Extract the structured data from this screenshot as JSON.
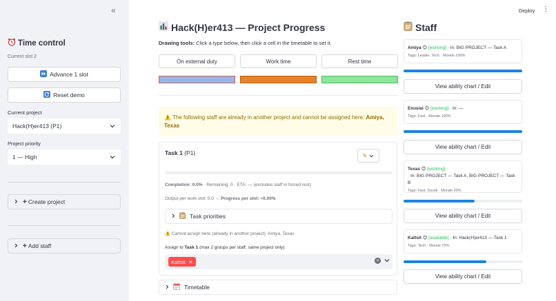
{
  "sidebar": {
    "collapse_glyph": "«",
    "time_control_title": "Time control",
    "current_slot": "Current slot 2",
    "advance_label": "Advance 1 slot",
    "reset_label": "Reset demo",
    "current_project_label": "Current project",
    "current_project_value": "Hack(H)er413 (P1)",
    "priority_label": "Project priority",
    "priority_value": "1 — High",
    "create_project_label": "Create project",
    "add_staff_label": "Add staff"
  },
  "topbar": {
    "deploy_label": "Deploy",
    "menu_glyph": "⋮"
  },
  "main": {
    "title": "Hack(H)er413 — Project Progress",
    "drawing_tools_bold": "Drawing tools:",
    "drawing_tools_text": " Click a type below, then click a cell in the timetable to set it.",
    "modes": [
      {
        "label": "On external duty",
        "color": "#8fb8ec",
        "border": "#e05a4f"
      },
      {
        "label": "Work time",
        "color": "#e8822a",
        "border": "#b85d12"
      },
      {
        "label": "Rest time",
        "color": "#8ee59c",
        "border": "#4fb862"
      }
    ],
    "warning_text": "The following staff are already in another project and cannot be assigned here: ",
    "warning_names": "Amiya, Texas",
    "task": {
      "name": "Task 1",
      "priority": " (P1)",
      "edit_glyph": "✎",
      "completion_label": "Completion: 0.0%",
      "completion_rest": " · Remaining: 0 · ETA: — (excludes staff in forced rest)",
      "output_text": "Output per work slot: 0.0 → ",
      "output_bold": "Progress per slot: +0.00%",
      "priorities_label": "Task priorities",
      "cannot_assign": "Cannot assign here (already in another project): Amiya, Texas",
      "assign_prefix": "Assign to ",
      "assign_task": "Task 1",
      "assign_suffix": " (max 2 groups per staff; same project only)",
      "selected_tag": "Kaltsit",
      "progress": 0.0
    },
    "timetable_label": "Timetable"
  },
  "staff": {
    "title": "Staff",
    "button_label": "View ability chart / Edit",
    "members": [
      {
        "name": "Amiya",
        "status": "[working]",
        "projects": " · In: BIG PROJECT — Task A",
        "tags": "Tags: Leader, Tech · Morale 100%",
        "morale": 1.0
      },
      {
        "name": "Exusiai",
        "status": "[working]",
        "projects": " · In: —",
        "tags": "Tags: Fast · Morale 100%",
        "morale": 1.0
      },
      {
        "name": "Texas",
        "status": "[working]",
        "projects": "· In: BIG PROJECT — Task A, BIG PROJECT — Task B",
        "tags": "Tags: Fast, Social · Morale 60%",
        "morale": 0.6
      },
      {
        "name": "Kaltsit",
        "status": "[available]",
        "projects": " · In: Hack(H)er413 — Task 1",
        "tags": "Tags: Tech · Morale 70%",
        "morale": 0.7
      }
    ]
  }
}
